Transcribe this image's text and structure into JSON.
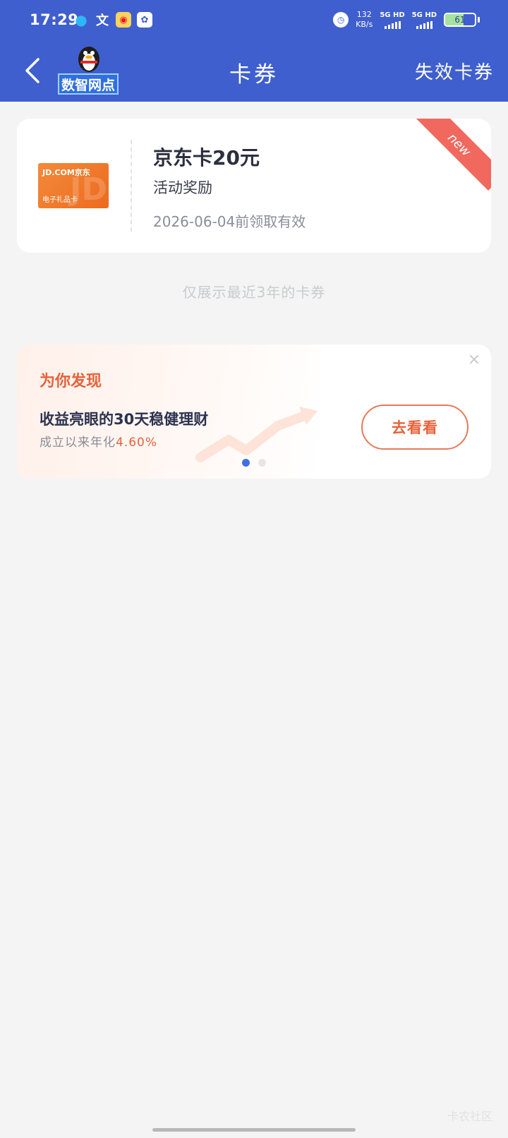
{
  "status_bar": {
    "time": "17:29",
    "net_speed_value": "132",
    "net_speed_unit": "KB/s",
    "sim1_label": "5G HD",
    "sim2_label": "5G HD",
    "battery_level": "61",
    "wen_glyph": "文"
  },
  "header": {
    "logo_text": "数智网点",
    "title": "卡券",
    "expired_link": "失效卡券"
  },
  "coupon": {
    "card_brand": "JD.COM京东",
    "card_sub": "电子礼品卡",
    "card_watermark": "JD",
    "name": "京东卡20元",
    "source": "活动奖励",
    "valid_until": "2026-06-04前领取有效",
    "badge": "new"
  },
  "note": "仅展示最近3年的卡券",
  "promo": {
    "title": "为你发现",
    "headline": "收益亮眼的30天稳健理财",
    "rate_label": "成立以来年化",
    "rate_value": "4.60%",
    "button_label": "去看看",
    "carousel_active_index": 0,
    "carousel_count": 2
  },
  "watermark": "卡农社区",
  "colors": {
    "header_bg": "#3f5fcf",
    "accent_orange": "#e8623a",
    "ribbon": "#f0685e",
    "dot_active": "#3f6fdf"
  }
}
